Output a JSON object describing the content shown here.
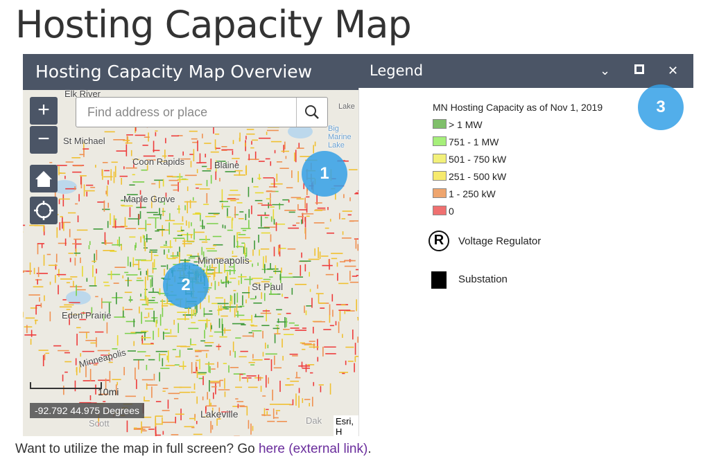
{
  "page_title": "Hosting Capacity Map",
  "map_panel": {
    "title": "Hosting Capacity Map Overview",
    "zoom_in": "+",
    "zoom_out": "−",
    "search_placeholder": "Find address or place",
    "scale_label": "10mi",
    "coordinates": "-92.792 44.975 Degrees",
    "attribution": "Esri, H",
    "places": [
      "Elk River",
      "St Michael",
      "Coon Rapids",
      "Blaine",
      "Maple Grove",
      "Minneapolis",
      "St Paul",
      "Eden Prairie",
      "Minneapolis",
      "Lakeville",
      "Scott",
      "Dak",
      "Big Marine Lake",
      "Lake"
    ]
  },
  "legend_panel": {
    "title": "Legend",
    "layer_title": "MN Hosting Capacity as of Nov 1, 2019",
    "classes": [
      {
        "label": "> 1 MW",
        "color": "#7fbf6a"
      },
      {
        "label": "751 - 1 MW",
        "color": "#a6ef7a"
      },
      {
        "label": "501 - 750 kW",
        "color": "#f2f07a"
      },
      {
        "label": "251 - 500 kW",
        "color": "#f6ea6e"
      },
      {
        "label": "1 - 250 kW",
        "color": "#eea56e"
      },
      {
        "label": "0",
        "color": "#ef7070"
      }
    ],
    "voltage_regulator": "Voltage Regulator",
    "regulator_symbol": "R",
    "substation": "Substation"
  },
  "callouts": [
    "1",
    "2",
    "3"
  ],
  "footer": {
    "text": "Want to utilize the map in full screen? Go ",
    "link": "here (external link)",
    "end": "."
  }
}
